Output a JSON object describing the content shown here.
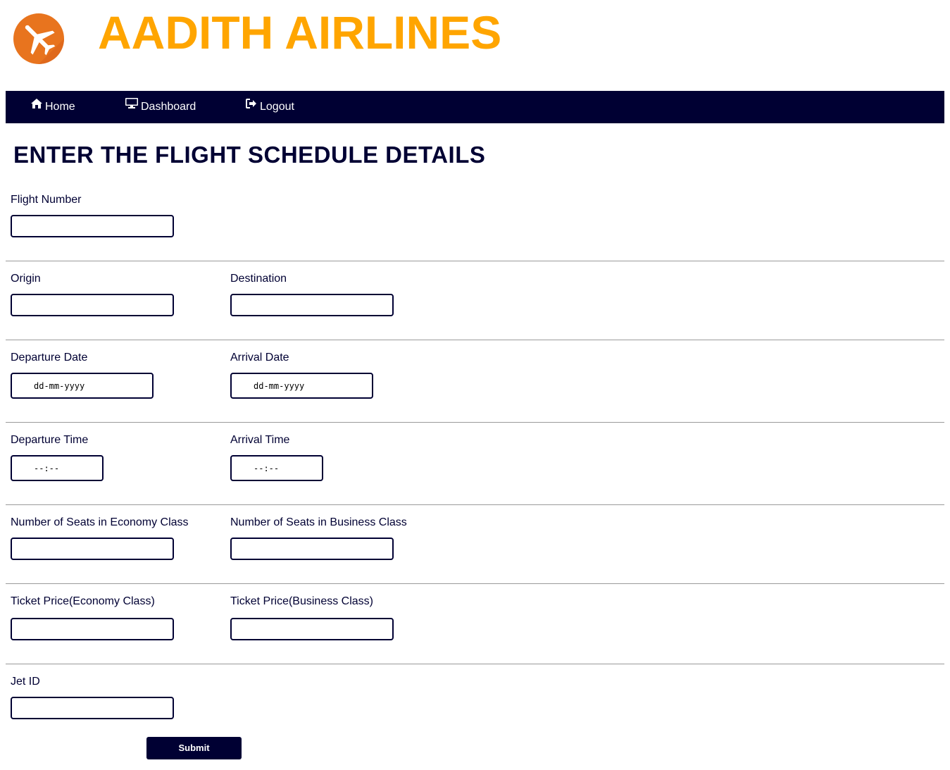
{
  "brand": {
    "name": "AADITH AIRLINES",
    "logo_icon": "airplane-icon",
    "color": "#ffa500",
    "logo_color": "#e8741e"
  },
  "nav": {
    "background": "#000033",
    "items": [
      {
        "label": "Home",
        "icon": "home-icon"
      },
      {
        "label": "Dashboard",
        "icon": "monitor-icon"
      },
      {
        "label": "Logout",
        "icon": "logout-icon"
      }
    ]
  },
  "page": {
    "title": "ENTER THE FLIGHT SCHEDULE DETAILS"
  },
  "form": {
    "flight_number": {
      "label": "Flight Number",
      "value": ""
    },
    "origin": {
      "label": "Origin",
      "value": ""
    },
    "destination": {
      "label": "Destination",
      "value": ""
    },
    "departure_date": {
      "label": "Departure Date",
      "placeholder": "dd-mm-yyyy"
    },
    "arrival_date": {
      "label": "Arrival Date",
      "placeholder": "dd-mm-yyyy"
    },
    "departure_time": {
      "label": "Departure Time",
      "placeholder": "--:--"
    },
    "arrival_time": {
      "label": "Arrival Time",
      "placeholder": "--:--"
    },
    "economy_seats": {
      "label": "Number of Seats in Economy Class",
      "value": ""
    },
    "business_seats": {
      "label": "Number of Seats in Business Class",
      "value": ""
    },
    "economy_price": {
      "label": "Ticket Price(Economy Class)",
      "value": ""
    },
    "business_price": {
      "label": "Ticket Price(Business Class)",
      "value": ""
    },
    "jet_id": {
      "label": "Jet ID",
      "value": ""
    },
    "submit_label": "Submit"
  }
}
